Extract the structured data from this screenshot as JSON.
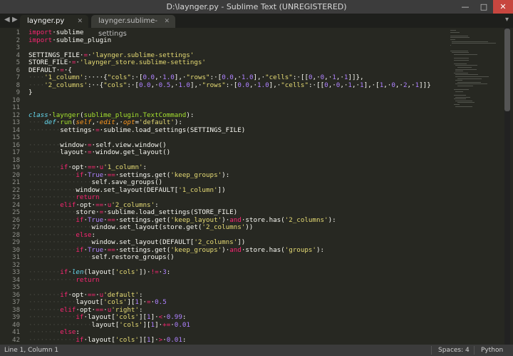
{
  "window": {
    "title": "D:\\laynger.py - Sublime Text (UNREGISTERED)",
    "minimize_glyph": "—",
    "maximize_glyph": "□",
    "close_glyph": "✕"
  },
  "tabs": [
    {
      "label": "laynger.py",
      "active": true
    },
    {
      "label": "laynger.sublime-settings",
      "active": false
    }
  ],
  "icons": {
    "nav_prev": "◀",
    "nav_next": "▶",
    "tab_close": "✕",
    "tab_menu": "▾"
  },
  "line_numbers": [
    "1",
    "2",
    "3",
    "4",
    "5",
    "6",
    "7",
    "8",
    "9",
    "10",
    "11",
    "12",
    "13",
    "14",
    "15",
    "16",
    "17",
    "18",
    "19",
    "20",
    "21",
    "22",
    "23",
    "24",
    "25",
    "26",
    "27",
    "28",
    "29",
    "30",
    "31",
    "32",
    "33",
    "34",
    "35",
    "36",
    "37",
    "38",
    "39",
    "40",
    "41",
    "42"
  ],
  "code_lines": [
    [
      {
        "t": "import",
        "c": "kw"
      },
      {
        "t": "·sublime"
      }
    ],
    [
      {
        "t": "import",
        "c": "kw"
      },
      {
        "t": "·sublime_plugin"
      }
    ],
    [
      {
        "t": ""
      }
    ],
    [
      {
        "t": "SETTINGS_FILE·"
      },
      {
        "t": "=",
        "c": "kw"
      },
      {
        "t": "·"
      },
      {
        "t": "'laynger.sublime-settings'",
        "c": "str"
      }
    ],
    [
      {
        "t": "STORE_FILE·"
      },
      {
        "t": "=",
        "c": "kw"
      },
      {
        "t": "·"
      },
      {
        "t": "'laynger_store.sublime-settings'",
        "c": "str"
      }
    ],
    [
      {
        "t": "DEFAULT·"
      },
      {
        "t": "=",
        "c": "kw"
      },
      {
        "t": "·{"
      }
    ],
    [
      {
        "t": "····",
        "c": "ws"
      },
      {
        "t": "'1_column'",
        "c": "str"
      },
      {
        "t": ":····{"
      },
      {
        "t": "\"cols\"",
        "c": "str"
      },
      {
        "t": ":·["
      },
      {
        "t": "0.0",
        "c": "num"
      },
      {
        "t": ",·"
      },
      {
        "t": "1.0",
        "c": "num"
      },
      {
        "t": "],·"
      },
      {
        "t": "\"rows\"",
        "c": "str"
      },
      {
        "t": ":·["
      },
      {
        "t": "0.0",
        "c": "num"
      },
      {
        "t": ",·"
      },
      {
        "t": "1.0",
        "c": "num"
      },
      {
        "t": "],·"
      },
      {
        "t": "\"cells\"",
        "c": "str"
      },
      {
        "t": ":·[["
      },
      {
        "t": "0",
        "c": "num"
      },
      {
        "t": ",·"
      },
      {
        "t": "0",
        "c": "num"
      },
      {
        "t": ",·"
      },
      {
        "t": "1",
        "c": "num"
      },
      {
        "t": ",·"
      },
      {
        "t": "1",
        "c": "num"
      },
      {
        "t": "]]},"
      }
    ],
    [
      {
        "t": "····",
        "c": "ws"
      },
      {
        "t": "'2_columns'",
        "c": "str"
      },
      {
        "t": ":··{"
      },
      {
        "t": "\"cols\"",
        "c": "str"
      },
      {
        "t": ":·["
      },
      {
        "t": "0.0",
        "c": "num"
      },
      {
        "t": ",·"
      },
      {
        "t": "0.5",
        "c": "num"
      },
      {
        "t": ",·"
      },
      {
        "t": "1.0",
        "c": "num"
      },
      {
        "t": "],·"
      },
      {
        "t": "\"rows\"",
        "c": "str"
      },
      {
        "t": ":·["
      },
      {
        "t": "0.0",
        "c": "num"
      },
      {
        "t": ",·"
      },
      {
        "t": "1.0",
        "c": "num"
      },
      {
        "t": "],·"
      },
      {
        "t": "\"cells\"",
        "c": "str"
      },
      {
        "t": ":·[["
      },
      {
        "t": "0",
        "c": "num"
      },
      {
        "t": ",·"
      },
      {
        "t": "0",
        "c": "num"
      },
      {
        "t": ",·"
      },
      {
        "t": "1",
        "c": "num"
      },
      {
        "t": ",·"
      },
      {
        "t": "1",
        "c": "num"
      },
      {
        "t": "],·["
      },
      {
        "t": "1",
        "c": "num"
      },
      {
        "t": ",·"
      },
      {
        "t": "0",
        "c": "num"
      },
      {
        "t": ",·"
      },
      {
        "t": "2",
        "c": "num"
      },
      {
        "t": ",·"
      },
      {
        "t": "1",
        "c": "num"
      },
      {
        "t": "]]}"
      }
    ],
    [
      {
        "t": "}"
      }
    ],
    [
      {
        "t": ""
      }
    ],
    [
      {
        "t": ""
      }
    ],
    [
      {
        "t": "class",
        "c": "cls"
      },
      {
        "t": "·"
      },
      {
        "t": "laynger",
        "c": "fn"
      },
      {
        "t": "("
      },
      {
        "t": "sublime_plugin.TextCommand",
        "c": "fn"
      },
      {
        "t": "):"
      }
    ],
    [
      {
        "t": "····",
        "c": "ws"
      },
      {
        "t": "def",
        "c": "cls"
      },
      {
        "t": "·"
      },
      {
        "t": "run",
        "c": "fn"
      },
      {
        "t": "("
      },
      {
        "t": "self",
        "c": "arg"
      },
      {
        "t": ",·"
      },
      {
        "t": "edit",
        "c": "arg"
      },
      {
        "t": ",·"
      },
      {
        "t": "opt",
        "c": "arg"
      },
      {
        "t": "="
      },
      {
        "t": "'default'",
        "c": "str"
      },
      {
        "t": "):"
      }
    ],
    [
      {
        "t": "········",
        "c": "ws"
      },
      {
        "t": "settings·"
      },
      {
        "t": "=",
        "c": "kw"
      },
      {
        "t": "·sublime.load_settings(SETTINGS_FILE)"
      }
    ],
    [
      {
        "t": ""
      }
    ],
    [
      {
        "t": "········",
        "c": "ws"
      },
      {
        "t": "window·"
      },
      {
        "t": "=",
        "c": "kw"
      },
      {
        "t": "·self.view.window()"
      }
    ],
    [
      {
        "t": "········",
        "c": "ws"
      },
      {
        "t": "layout·"
      },
      {
        "t": "=",
        "c": "kw"
      },
      {
        "t": "·window.get_layout()"
      }
    ],
    [
      {
        "t": ""
      }
    ],
    [
      {
        "t": "········",
        "c": "ws"
      },
      {
        "t": "if",
        "c": "kw"
      },
      {
        "t": "·opt·"
      },
      {
        "t": "==",
        "c": "kw"
      },
      {
        "t": "·"
      },
      {
        "t": "u",
        "c": "kw"
      },
      {
        "t": "'1_column'",
        "c": "str"
      },
      {
        "t": ":"
      }
    ],
    [
      {
        "t": "············",
        "c": "ws"
      },
      {
        "t": "if",
        "c": "kw"
      },
      {
        "t": "·"
      },
      {
        "t": "True",
        "c": "num"
      },
      {
        "t": "·"
      },
      {
        "t": "==",
        "c": "kw"
      },
      {
        "t": "·settings.get("
      },
      {
        "t": "'keep_groups'",
        "c": "str"
      },
      {
        "t": "):"
      }
    ],
    [
      {
        "t": "················",
        "c": "ws"
      },
      {
        "t": "self.save_groups()"
      }
    ],
    [
      {
        "t": "············",
        "c": "ws"
      },
      {
        "t": "window.set_layout(DEFAULT["
      },
      {
        "t": "'1_column'",
        "c": "str"
      },
      {
        "t": "])"
      }
    ],
    [
      {
        "t": "············",
        "c": "ws"
      },
      {
        "t": "return",
        "c": "kw"
      }
    ],
    [
      {
        "t": "········",
        "c": "ws"
      },
      {
        "t": "elif",
        "c": "kw"
      },
      {
        "t": "·opt·"
      },
      {
        "t": "==",
        "c": "kw"
      },
      {
        "t": "·"
      },
      {
        "t": "u",
        "c": "kw"
      },
      {
        "t": "'2_columns'",
        "c": "str"
      },
      {
        "t": ":"
      }
    ],
    [
      {
        "t": "············",
        "c": "ws"
      },
      {
        "t": "store·"
      },
      {
        "t": "=",
        "c": "kw"
      },
      {
        "t": "·sublime.load_settings(STORE_FILE)"
      }
    ],
    [
      {
        "t": "············",
        "c": "ws"
      },
      {
        "t": "if",
        "c": "kw"
      },
      {
        "t": "·"
      },
      {
        "t": "True",
        "c": "num"
      },
      {
        "t": "·"
      },
      {
        "t": "==",
        "c": "kw"
      },
      {
        "t": "·settings.get("
      },
      {
        "t": "'keep_layout'",
        "c": "str"
      },
      {
        "t": ")·"
      },
      {
        "t": "and",
        "c": "kw"
      },
      {
        "t": "·store.has("
      },
      {
        "t": "'2_columns'",
        "c": "str"
      },
      {
        "t": "):"
      }
    ],
    [
      {
        "t": "················",
        "c": "ws"
      },
      {
        "t": "window.set_layout(store.get("
      },
      {
        "t": "'2_columns'",
        "c": "str"
      },
      {
        "t": "))"
      }
    ],
    [
      {
        "t": "············",
        "c": "ws"
      },
      {
        "t": "else",
        "c": "kw"
      },
      {
        "t": ":"
      }
    ],
    [
      {
        "t": "················",
        "c": "ws"
      },
      {
        "t": "window.set_layout(DEFAULT["
      },
      {
        "t": "'2_columns'",
        "c": "str"
      },
      {
        "t": "])"
      }
    ],
    [
      {
        "t": "············",
        "c": "ws"
      },
      {
        "t": "if",
        "c": "kw"
      },
      {
        "t": "·"
      },
      {
        "t": "True",
        "c": "num"
      },
      {
        "t": "·"
      },
      {
        "t": "==",
        "c": "kw"
      },
      {
        "t": "·settings.get("
      },
      {
        "t": "'keep_groups'",
        "c": "str"
      },
      {
        "t": ")·"
      },
      {
        "t": "and",
        "c": "kw"
      },
      {
        "t": "·store.has("
      },
      {
        "t": "'groups'",
        "c": "str"
      },
      {
        "t": "):"
      }
    ],
    [
      {
        "t": "················",
        "c": "ws"
      },
      {
        "t": "self.restore_groups()"
      }
    ],
    [
      {
        "t": ""
      }
    ],
    [
      {
        "t": "········",
        "c": "ws"
      },
      {
        "t": "if",
        "c": "kw"
      },
      {
        "t": "·"
      },
      {
        "t": "len",
        "c": "cls"
      },
      {
        "t": "(layout["
      },
      {
        "t": "'cols'",
        "c": "str"
      },
      {
        "t": "])·"
      },
      {
        "t": "!=",
        "c": "kw"
      },
      {
        "t": "·"
      },
      {
        "t": "3",
        "c": "num"
      },
      {
        "t": ":"
      }
    ],
    [
      {
        "t": "············",
        "c": "ws"
      },
      {
        "t": "return",
        "c": "kw"
      }
    ],
    [
      {
        "t": ""
      }
    ],
    [
      {
        "t": "········",
        "c": "ws"
      },
      {
        "t": "if",
        "c": "kw"
      },
      {
        "t": "·opt·"
      },
      {
        "t": "==",
        "c": "kw"
      },
      {
        "t": "·"
      },
      {
        "t": "u",
        "c": "kw"
      },
      {
        "t": "'default'",
        "c": "str"
      },
      {
        "t": ":"
      }
    ],
    [
      {
        "t": "············",
        "c": "ws"
      },
      {
        "t": "layout["
      },
      {
        "t": "'cols'",
        "c": "str"
      },
      {
        "t": "]["
      },
      {
        "t": "1",
        "c": "num"
      },
      {
        "t": "]·"
      },
      {
        "t": "=",
        "c": "kw"
      },
      {
        "t": "·"
      },
      {
        "t": "0.5",
        "c": "num"
      }
    ],
    [
      {
        "t": "········",
        "c": "ws"
      },
      {
        "t": "elif",
        "c": "kw"
      },
      {
        "t": "·opt·"
      },
      {
        "t": "==",
        "c": "kw"
      },
      {
        "t": "·"
      },
      {
        "t": "u",
        "c": "kw"
      },
      {
        "t": "'right'",
        "c": "str"
      },
      {
        "t": ":"
      }
    ],
    [
      {
        "t": "············",
        "c": "ws"
      },
      {
        "t": "if",
        "c": "kw"
      },
      {
        "t": "·layout["
      },
      {
        "t": "'cols'",
        "c": "str"
      },
      {
        "t": "]["
      },
      {
        "t": "1",
        "c": "num"
      },
      {
        "t": "]·"
      },
      {
        "t": "<",
        "c": "kw"
      },
      {
        "t": "·"
      },
      {
        "t": "0.99",
        "c": "num"
      },
      {
        "t": ":"
      }
    ],
    [
      {
        "t": "················",
        "c": "ws"
      },
      {
        "t": "layout["
      },
      {
        "t": "'cols'",
        "c": "str"
      },
      {
        "t": "]["
      },
      {
        "t": "1",
        "c": "num"
      },
      {
        "t": "]·"
      },
      {
        "t": "+=",
        "c": "kw"
      },
      {
        "t": "·"
      },
      {
        "t": "0.01",
        "c": "num"
      }
    ],
    [
      {
        "t": "········",
        "c": "ws"
      },
      {
        "t": "else",
        "c": "kw"
      },
      {
        "t": ":"
      }
    ],
    [
      {
        "t": "············",
        "c": "ws"
      },
      {
        "t": "if",
        "c": "kw"
      },
      {
        "t": "·layout["
      },
      {
        "t": "'cols'",
        "c": "str"
      },
      {
        "t": "]["
      },
      {
        "t": "1",
        "c": "num"
      },
      {
        "t": "]·"
      },
      {
        "t": ">",
        "c": "kw"
      },
      {
        "t": "·"
      },
      {
        "t": "0.01",
        "c": "num"
      },
      {
        "t": ":"
      }
    ]
  ],
  "status": {
    "position": "Line 1, Column 1",
    "spaces": "Spaces: 4",
    "syntax": "Python"
  },
  "colors": {
    "keyword": "#f92672",
    "string": "#e6db74",
    "number": "#ae81ff",
    "function": "#a6e22e",
    "storage": "#66d9ef",
    "argument": "#fd971f",
    "background": "#272822"
  }
}
